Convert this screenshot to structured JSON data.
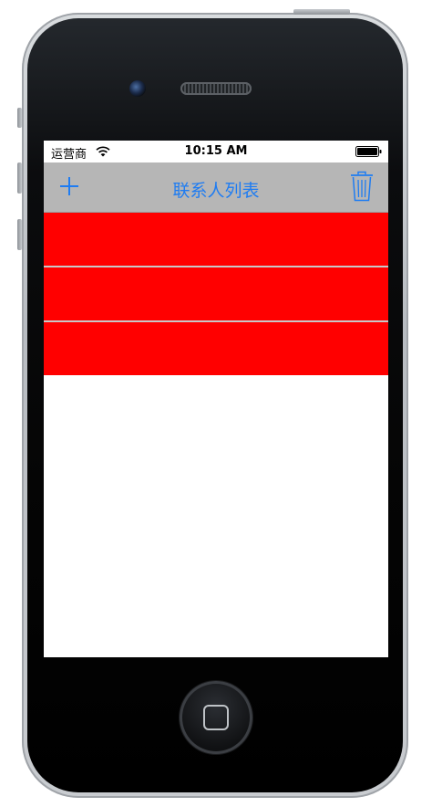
{
  "status_bar": {
    "carrier": "运营商",
    "time": "10:15 AM"
  },
  "nav_bar": {
    "title": "联系人列表",
    "left_icon": "plus-icon",
    "right_icon": "trash-icon",
    "accent_color": "#1e7cf2",
    "background_color": "#b6b6b6"
  },
  "table": {
    "rows": [
      {
        "label": ""
      },
      {
        "label": ""
      },
      {
        "label": ""
      }
    ],
    "row_color": "#ff0000"
  }
}
